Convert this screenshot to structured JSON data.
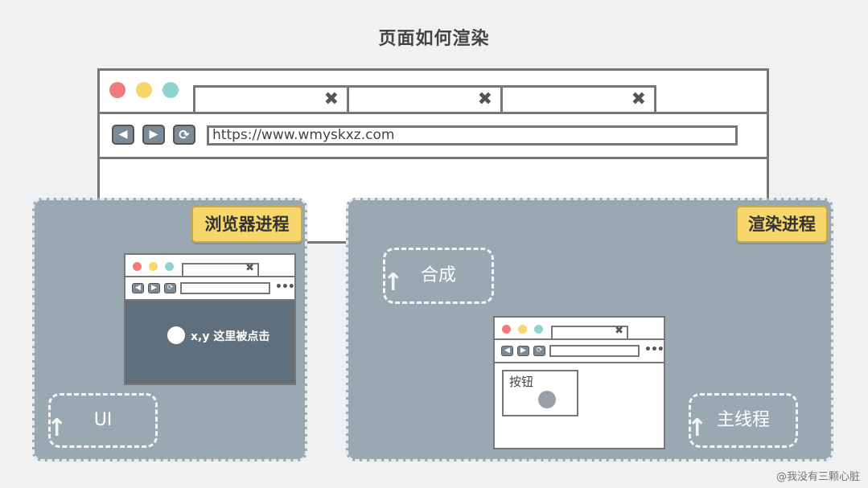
{
  "title": "页面如何渲染",
  "browser": {
    "tabs": [
      {
        "close": "✖"
      },
      {
        "close": "✖"
      },
      {
        "close": "✖"
      }
    ],
    "nav": {
      "back": "◀",
      "forward": "▶",
      "refresh": "⟳"
    },
    "url": "https://www.wmyskxz.com",
    "traffic_lights": {
      "red": "#f07b7b",
      "yellow": "#f7d66b",
      "green": "#8fd3cf"
    }
  },
  "browser_process": {
    "label": "浏览器进程",
    "click_text": "x,y 这里被点击",
    "ui_label": "UI"
  },
  "renderer_process": {
    "label": "渲染进程",
    "composite_label": "合成",
    "main_thread_label": "主线程",
    "button_label": "按钮"
  },
  "watermark": "@我没有三颗心脏",
  "colors": {
    "panel": "#9aa8b1",
    "tag": "#f7d66b",
    "mini_content": "#5f6f7b"
  }
}
